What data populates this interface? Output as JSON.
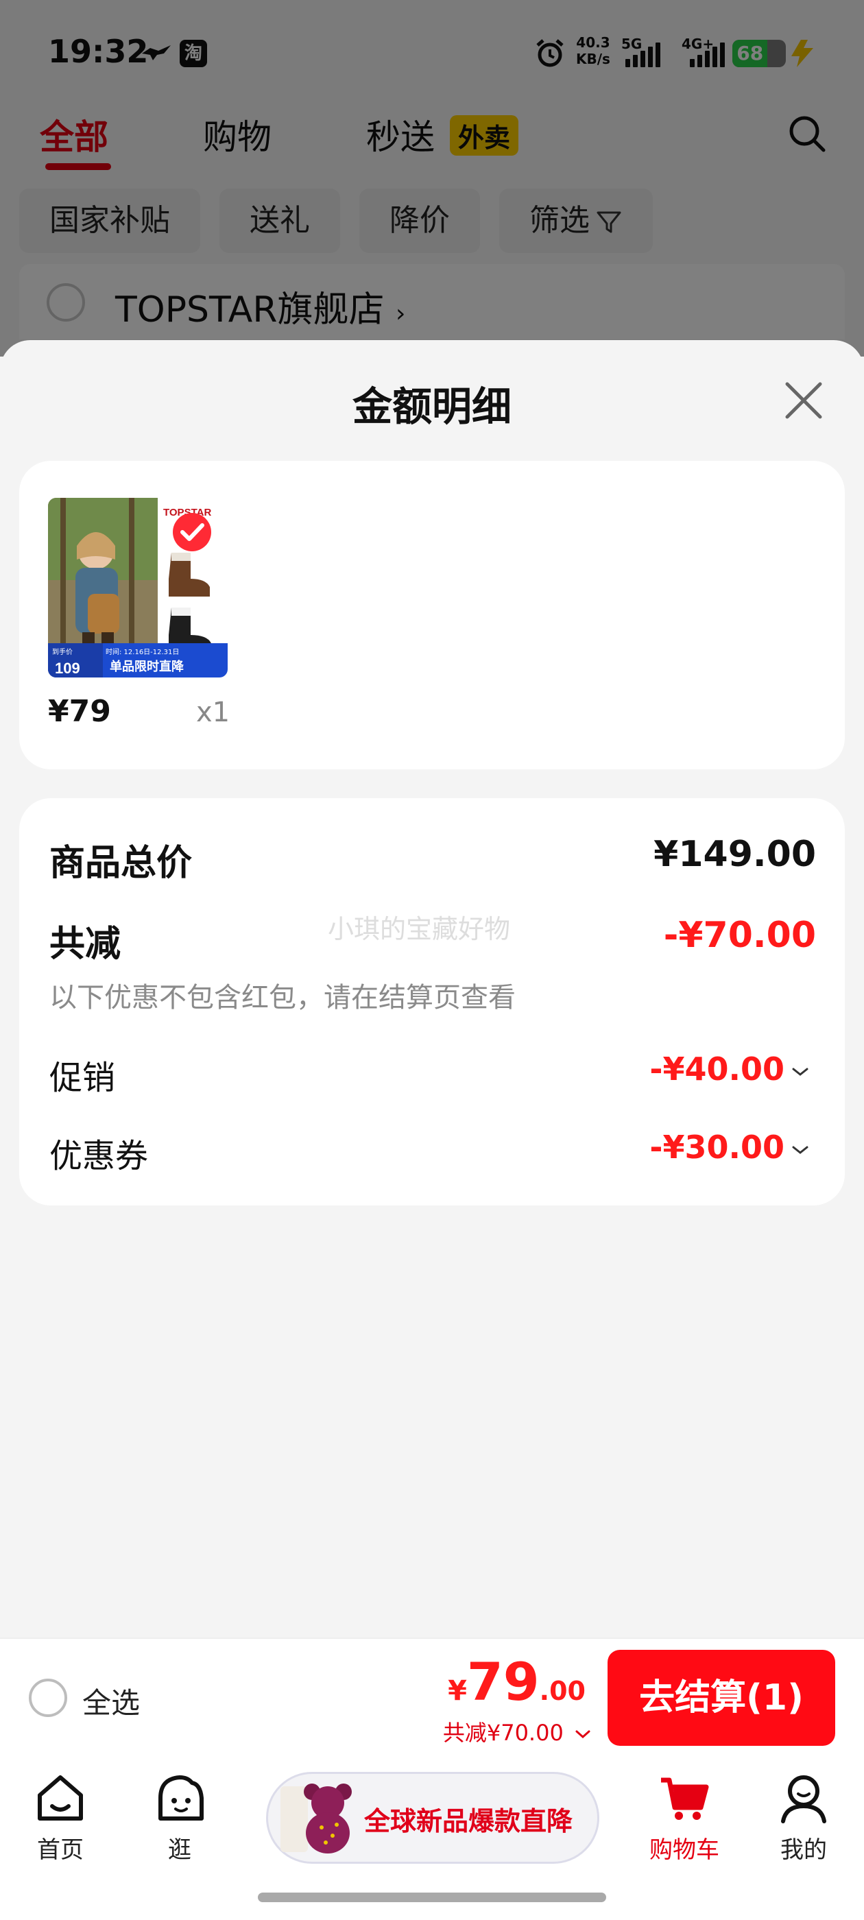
{
  "status_bar": {
    "time": "19:32",
    "net_speed": "40.3",
    "net_unit": "KB/s",
    "sim1": "5G",
    "sim2": "4G+",
    "battery": "68",
    "tao_icon": "淘"
  },
  "top_tabs": {
    "all": "全部",
    "shopping": "购物",
    "express": "秒送",
    "takeaway_badge": "外卖"
  },
  "filters": [
    "国家补贴",
    "送礼",
    "降价",
    "筛选"
  ],
  "store": {
    "name": "TOPSTAR旗舰店"
  },
  "sheet": {
    "title": "金额明细",
    "item": {
      "price": "¥79",
      "qty": "x1",
      "brand": "TOPSTAR",
      "promo_price": "109",
      "promo_text": "单品限时直降",
      "promo_small": "到手价",
      "promo_date": "时间: 12.16日-12.31日"
    },
    "watermark": "小琪的宝藏好物",
    "total_label": "商品总价",
    "total_value": "¥149.00",
    "discount_label": "共减",
    "discount_value": "-¥70.00",
    "discount_note": "以下优惠不包含红包，请在结算页查看",
    "promo_label": "促销",
    "promo_value": "-¥40.00",
    "coupon_label": "优惠券",
    "coupon_value": "-¥30.00"
  },
  "checkout": {
    "select_all": "全选",
    "currency": "¥",
    "amount_int": "79",
    "amount_dec": ".00",
    "saved": "共减¥70.00",
    "button": "去结算(1)"
  },
  "tabbar": {
    "home": "首页",
    "browse": "逛",
    "promo": "全球新品爆款直降",
    "cart": "购物车",
    "mine": "我的"
  },
  "colors": {
    "accent": "#e50012",
    "price_red": "#ff1a1a",
    "button_red": "#ff0a14",
    "takeaway_yellow": "#ffce00"
  }
}
